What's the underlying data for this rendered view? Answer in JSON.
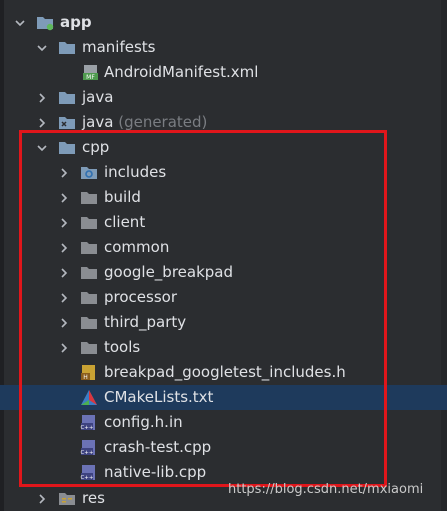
{
  "tree": {
    "app_label": "app",
    "manifests_label": "manifests",
    "manifest_file_label": "AndroidManifest.xml",
    "java_label": "java",
    "java_generated_label": "java",
    "java_generated_hint": "(generated)",
    "cpp_label": "cpp",
    "cpp_children": {
      "includes": "includes",
      "build": "build",
      "client": "client",
      "common": "common",
      "google_breakpad": "google_breakpad",
      "processor": "processor",
      "third_party": "third_party",
      "tools": "tools",
      "breakpad_header": "breakpad_googletest_includes.h",
      "cmakelists": "CMakeLists.txt",
      "config": "config.h.in",
      "crash_test": "crash-test.cpp",
      "native_lib": "native-lib.cpp"
    },
    "res_label": "res"
  },
  "watermark": "https://blog.csdn.net/mxiaomi",
  "colors": {
    "background": "#2b2d30",
    "folder": "#7e9bb8",
    "selection": "#1e3a5c",
    "highlight_box": "#e0161b"
  }
}
